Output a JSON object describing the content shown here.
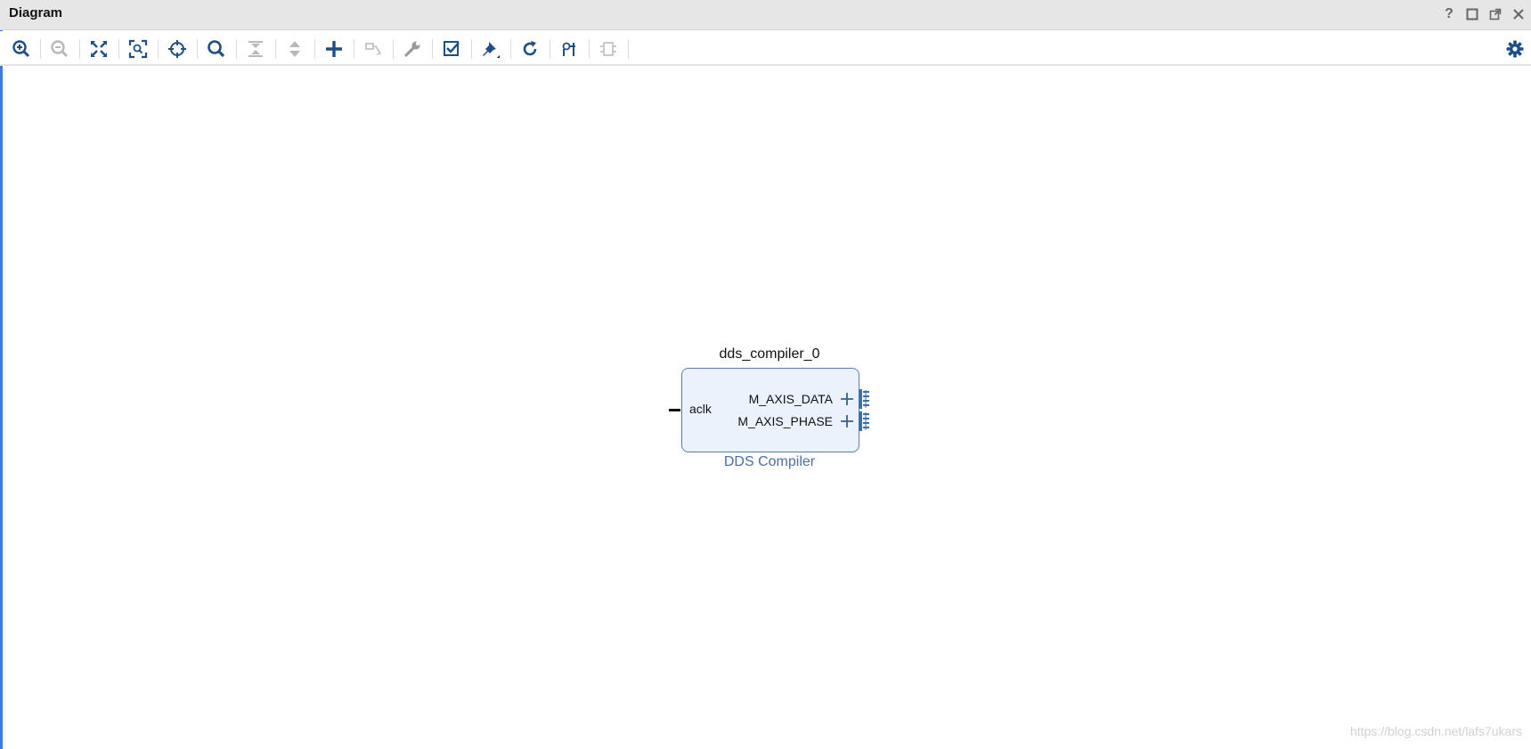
{
  "window": {
    "title": "Diagram"
  },
  "title_controls": [
    "help-icon",
    "maximize-icon",
    "float-icon",
    "close-icon"
  ],
  "toolbar": {
    "buttons": [
      {
        "name": "zoom-in-icon",
        "enabled": true
      },
      {
        "name": "zoom-out-icon",
        "enabled": false
      },
      {
        "name": "zoom-fit-icon",
        "enabled": true
      },
      {
        "name": "zoom-selection-icon",
        "enabled": true
      },
      {
        "name": "auto-fit-selection-icon",
        "enabled": true
      },
      {
        "name": "search-icon",
        "enabled": true
      },
      {
        "name": "collapse-all-icon",
        "enabled": false
      },
      {
        "name": "expand-all-icon",
        "enabled": false
      },
      {
        "name": "add-ip-icon",
        "enabled": true
      },
      {
        "name": "make-connection-icon",
        "enabled": false
      },
      {
        "name": "wrench-icon",
        "enabled": true
      },
      {
        "name": "validate-design-icon",
        "enabled": true
      },
      {
        "name": "pin-icon",
        "enabled": true
      },
      {
        "name": "regenerate-layout-icon",
        "enabled": true
      },
      {
        "name": "optimize-routing-icon",
        "enabled": true
      },
      {
        "name": "create-hierarchy-icon",
        "enabled": false
      }
    ],
    "settings_icon": "gear-icon"
  },
  "block": {
    "instance_name": "dds_compiler_0",
    "type_label": "DDS Compiler",
    "input_port": "aclk",
    "output_ports": [
      "M_AXIS_DATA",
      "M_AXIS_PHASE"
    ]
  },
  "watermark": "https://blog.csdn.net/lafs7ukars",
  "colors": {
    "accent": "#3b7ddd",
    "icon": "#1e4f86",
    "block_fill": "#eaf2fc",
    "block_border": "#5a7fae",
    "type_label": "#4a6fa5"
  }
}
